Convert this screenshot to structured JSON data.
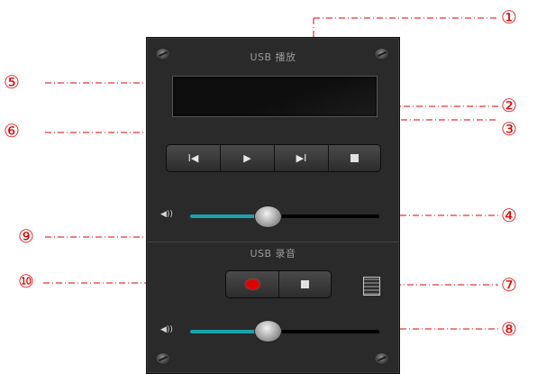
{
  "panel": {
    "playback_title": "USB 播放",
    "record_title": "USB 录音",
    "playback_volume": 0.41,
    "record_volume": 0.41
  },
  "icons": {
    "prev": "previous-track-icon",
    "play": "play-icon",
    "next": "next-track-icon",
    "stop": "stop-icon",
    "record": "record-icon",
    "volume": "speaker-volume-icon",
    "file": "recordings-file-icon"
  },
  "glyphs": {
    "prev": "I◀",
    "play": "▶",
    "next": "▶I",
    "volume": "◀))"
  },
  "callouts": [
    "①",
    "②",
    "③",
    "④",
    "⑤",
    "⑥",
    "⑦",
    "⑧",
    "⑨",
    "⑩"
  ],
  "colors": {
    "annotation": "#e00000",
    "slider_fill": "#1aa3ad",
    "record_dot": "#e00000"
  }
}
